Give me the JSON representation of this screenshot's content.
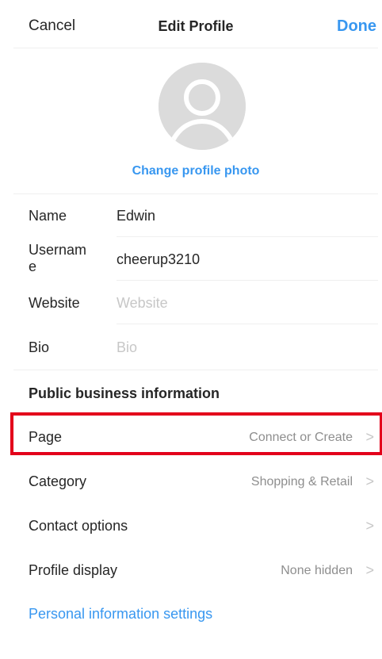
{
  "nav": {
    "cancel_label": "Cancel",
    "title": "Edit Profile",
    "done_label": "Done"
  },
  "profile_photo": {
    "change_label": "Change profile photo"
  },
  "fields": {
    "name": {
      "label": "Name",
      "value": "Edwin"
    },
    "username": {
      "label": "Usernam\ne",
      "value": "cheerup3210"
    },
    "website": {
      "label": "Website",
      "placeholder": "Website"
    },
    "bio": {
      "label": "Bio",
      "placeholder": "Bio"
    }
  },
  "business": {
    "title": "Public business information",
    "rows": [
      {
        "label": "Page",
        "value": "Connect or Create"
      },
      {
        "label": "Category",
        "value": "Shopping & Retail"
      },
      {
        "label": "Contact options",
        "value": ""
      },
      {
        "label": "Profile display",
        "value": "None hidden"
      }
    ]
  },
  "personal_info_link": "Personal information settings",
  "chevron_glyph": ">",
  "colors": {
    "accent": "#3897f0",
    "highlight": "#e3001b",
    "placeholder": "#c7c7c7"
  }
}
